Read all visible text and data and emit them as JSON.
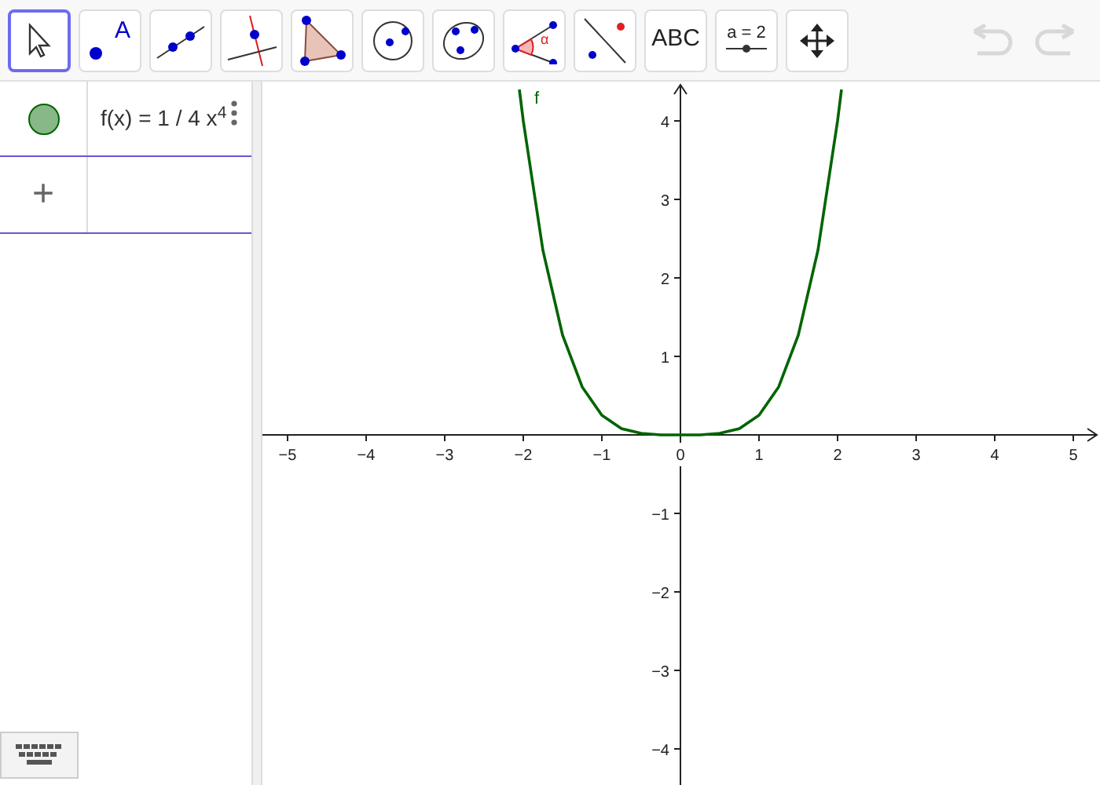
{
  "toolbar": {
    "tools": [
      {
        "kind": "move",
        "selected": true
      },
      {
        "kind": "point",
        "selected": false,
        "label": "A"
      },
      {
        "kind": "line",
        "selected": false
      },
      {
        "kind": "perpendicular",
        "selected": false
      },
      {
        "kind": "polygon",
        "selected": false
      },
      {
        "kind": "circle",
        "selected": false
      },
      {
        "kind": "conic",
        "selected": false
      },
      {
        "kind": "angle",
        "selected": false,
        "label": "α"
      },
      {
        "kind": "reflect",
        "selected": false
      },
      {
        "kind": "text",
        "selected": false,
        "label": "ABC"
      },
      {
        "kind": "slider",
        "selected": false,
        "label": "a = 2"
      },
      {
        "kind": "pan",
        "selected": false
      }
    ],
    "undo": {
      "disabled": true
    },
    "redo": {
      "disabled": true
    }
  },
  "algebra": {
    "items": [
      {
        "kind": "function",
        "visible": true,
        "color": "#006400",
        "text": "f(x) = 1 / 4 x$^{4}$"
      }
    ],
    "input": {
      "symbol": "+"
    }
  },
  "graphics": {
    "chart_data": {
      "type": "line",
      "x": [
        -2.05,
        -2,
        -1.75,
        -1.5,
        -1.25,
        -1,
        -0.75,
        -0.5,
        -0.25,
        0,
        0.25,
        0.5,
        0.75,
        1,
        1.25,
        1.5,
        1.75,
        2,
        2.05
      ],
      "series": [
        {
          "name": "f",
          "color": "#006400",
          "values": [
            4.4,
            4,
            2.35,
            1.27,
            0.61,
            0.25,
            0.08,
            0.02,
            0,
            0,
            0,
            0.02,
            0.08,
            0.25,
            0.61,
            1.27,
            2.35,
            4,
            4.4
          ]
        }
      ],
      "xlim": [
        -5.32,
        5.34
      ],
      "ylim": [
        -4.46,
        4.5
      ],
      "xticks": [
        {
          "value": -5,
          "label": "−5"
        },
        {
          "value": -4,
          "label": "−4"
        },
        {
          "value": -3,
          "label": "−3"
        },
        {
          "value": -2,
          "label": "−2"
        },
        {
          "value": -1,
          "label": "−1"
        },
        {
          "value": 0,
          "label": "0"
        },
        1,
        2,
        3,
        4,
        5
      ],
      "yticks": [
        {
          "value": -4,
          "label": "−4"
        },
        {
          "value": -3,
          "label": "−3"
        },
        {
          "value": -2,
          "label": "−2"
        },
        {
          "value": -1,
          "label": "−1"
        },
        1,
        2,
        3,
        4
      ]
    }
  },
  "keyboard_button": {
    "visible": true
  }
}
